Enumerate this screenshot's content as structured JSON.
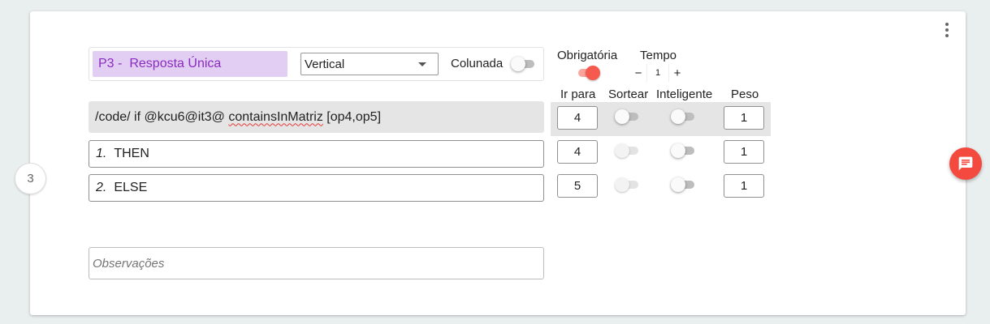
{
  "question": {
    "number": "3",
    "code": "P3 -",
    "title": "Resposta Única",
    "orientation": "Vertical",
    "colunada_label": "Colunada",
    "obrigatoria_label": "Obrigatória",
    "obrigatoria_on": true,
    "tempo_label": "Tempo",
    "tempo_value": "1",
    "tempo_minus": "−",
    "tempo_plus": "+"
  },
  "columns": {
    "ir_para": "Ir para",
    "sortear": "Sortear",
    "inteligente": "Inteligente",
    "peso": "Peso"
  },
  "code_row": {
    "prefix": "/code/ if @kcu6@it3@ ",
    "squiggly": "containsInMatriz",
    "suffix": " [op4,op5]",
    "ir_para": "4",
    "peso": "1"
  },
  "options": [
    {
      "number": "1.",
      "label": "THEN",
      "ir_para": "4",
      "peso": "1"
    },
    {
      "number": "2.",
      "label": "ELSE",
      "ir_para": "5",
      "peso": "1"
    }
  ],
  "observacoes_placeholder": "Observações",
  "icons": {
    "menu": "more-vert-icon",
    "caret": "chevron-down-icon",
    "chat": "chat-icon"
  },
  "colors": {
    "accent": "#f65a4e",
    "title_bg": "#e2cdf3",
    "title_text": "#8a2cc0",
    "code_bg": "#e5e5e5"
  }
}
